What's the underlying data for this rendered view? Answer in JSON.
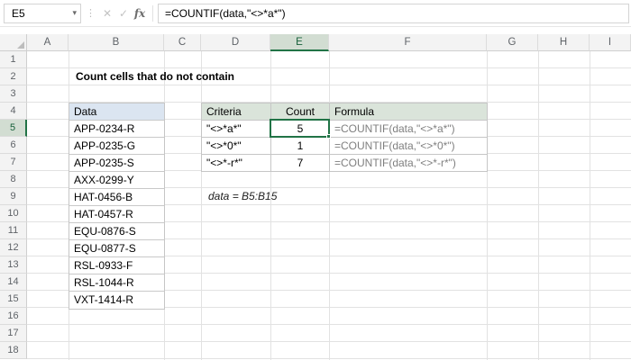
{
  "formula_bar": {
    "name_box": "E5",
    "dropdown_icon": "▾",
    "cancel_icon": "✕",
    "enter_icon": "✓",
    "fx_label": "fx",
    "formula": "=COUNTIF(data,\"<>*a*\")"
  },
  "grid": {
    "columns": [
      "A",
      "B",
      "C",
      "D",
      "E",
      "F",
      "G",
      "H",
      "I"
    ],
    "rows": [
      "1",
      "2",
      "3",
      "4",
      "5",
      "6",
      "7",
      "8",
      "9",
      "10",
      "11",
      "12",
      "13",
      "14",
      "15",
      "16",
      "17",
      "18"
    ],
    "selected_cell": "E5"
  },
  "sheet": {
    "title": "Count cells that do not contain",
    "data_column": {
      "header": "Data",
      "values": [
        "APP-0234-R",
        "APP-0235-G",
        "APP-0235-S",
        "AXX-0299-Y",
        "HAT-0456-B",
        "HAT-0457-R",
        "EQU-0876-S",
        "EQU-0877-S",
        "RSL-0933-F",
        "RSL-1044-R",
        "VXT-1414-R"
      ]
    },
    "formula_table": {
      "headers": {
        "criteria": "Criteria",
        "count": "Count",
        "formula": "Formula"
      },
      "rows": [
        {
          "criteria": "\"<>*a*\"",
          "count": "5",
          "formula": "=COUNTIF(data,\"<>*a*\")"
        },
        {
          "criteria": "\"<>*0*\"",
          "count": "1",
          "formula": "=COUNTIF(data,\"<>*0*\")"
        },
        {
          "criteria": "\"<>*-r*\"",
          "count": "7",
          "formula": "=COUNTIF(data,\"<>*-r*\")"
        }
      ]
    },
    "note": "data = B5:B15"
  },
  "colors": {
    "accent_green": "#217346",
    "selected_header_fill": "#d2ddd2",
    "data_header_fill": "#dbe5f1",
    "table_header_fill": "#dae4da",
    "formula_text": "#7f7f7f",
    "gridline": "#e2e2e2"
  }
}
